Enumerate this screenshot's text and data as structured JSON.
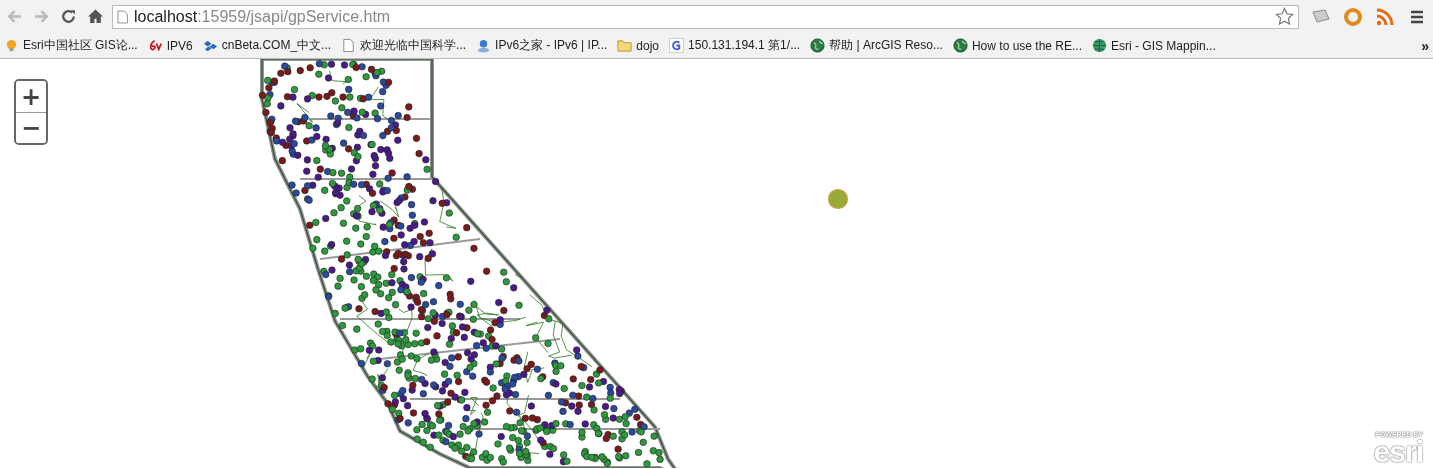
{
  "address_bar": {
    "host": "localhost",
    "path": ":15959/jsapi/gpService.htm"
  },
  "bookmarks": [
    {
      "label": "Esri中国社区 GIS论...",
      "kind": "bulb"
    },
    {
      "label": "IPV6",
      "kind": "six"
    },
    {
      "label": "cnBeta.COM_中文...",
      "kind": "cubes"
    },
    {
      "label": "欢迎光临中国科学...",
      "kind": "page"
    },
    {
      "label": "IPv6之家 - IPv6 | IP...",
      "kind": "person"
    },
    {
      "label": "dojo",
      "kind": "folder"
    },
    {
      "label": "150.131.194.1 第1/...",
      "kind": "g"
    },
    {
      "label": "帮助 | ArcGIS Reso...",
      "kind": "globe"
    },
    {
      "label": "How to use the RE...",
      "kind": "globe"
    },
    {
      "label": "Esri - GIS Mappin...",
      "kind": "grid"
    }
  ],
  "more_bookmarks": "»",
  "zoom_controls": {
    "zoom_in": "+",
    "zoom_out": "−"
  },
  "attribution": {
    "small": "POWERED BY",
    "logo": "esri"
  }
}
